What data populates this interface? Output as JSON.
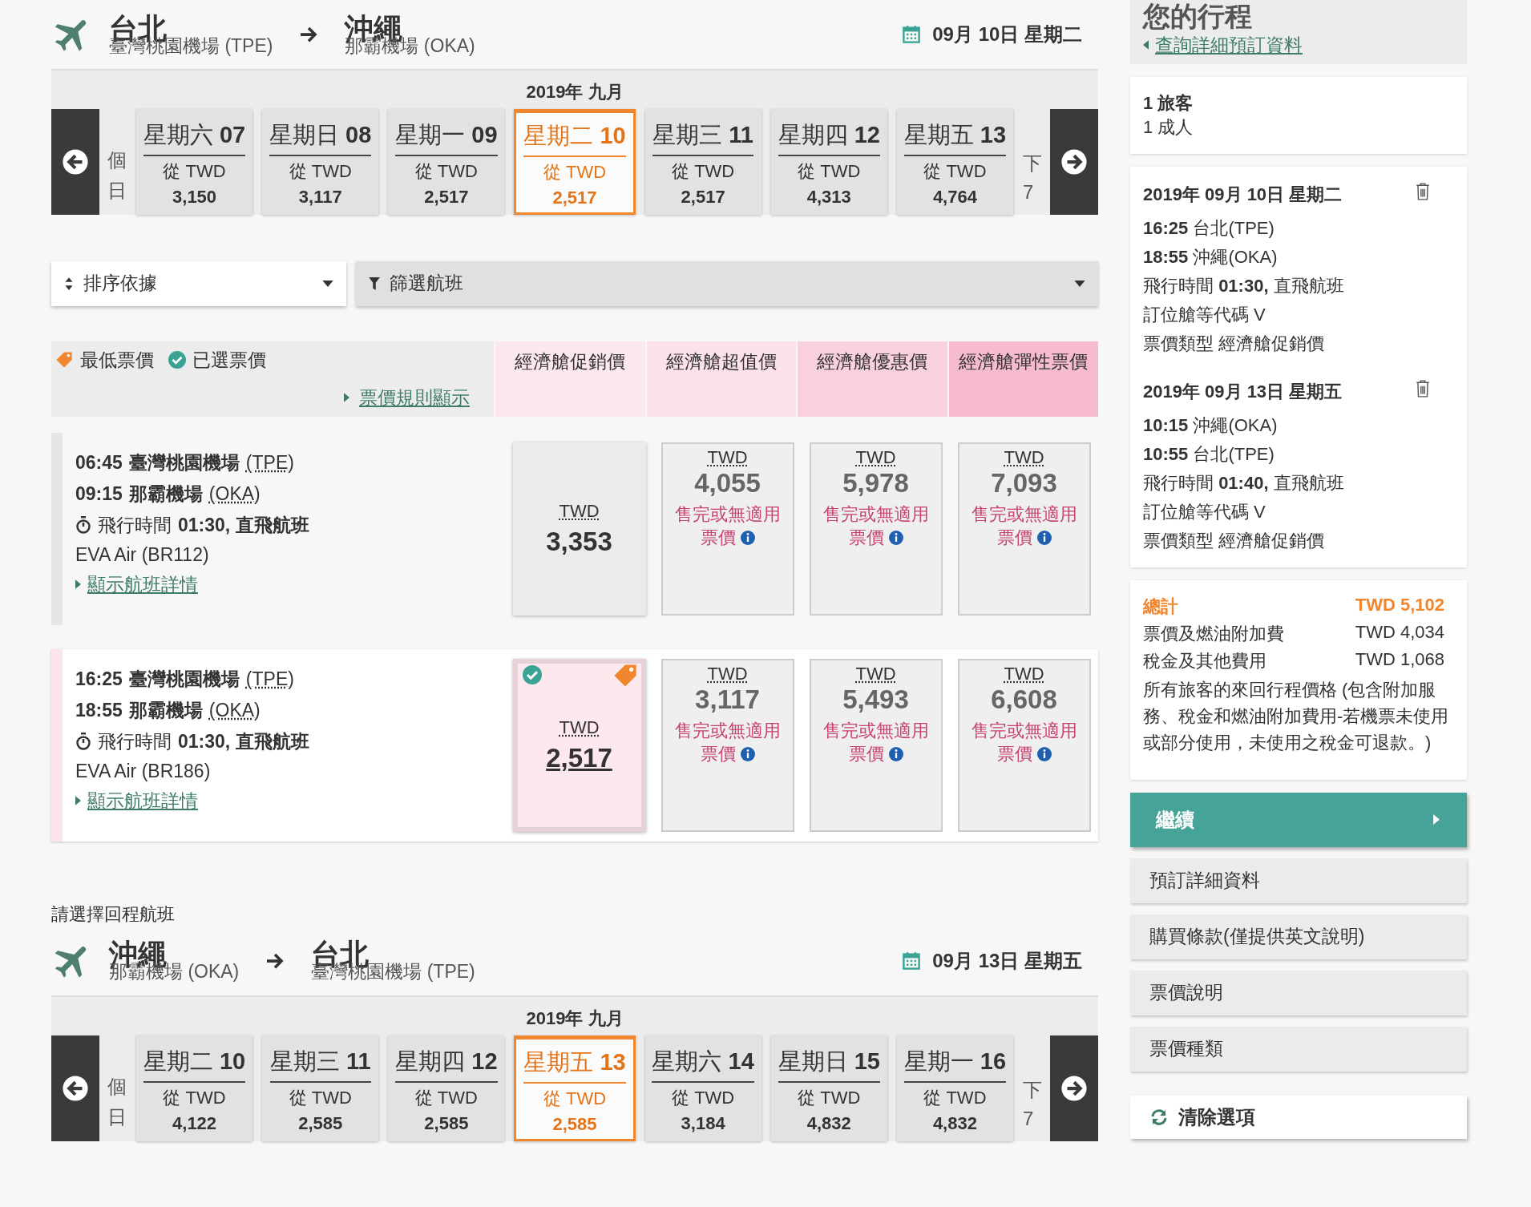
{
  "outbound": {
    "origin_city": "台北",
    "origin_airport": "臺灣桃園機場 (TPE)",
    "dest_city": "沖繩",
    "dest_airport": "那霸機場 (OKA)",
    "date": "09月 10日 星期二",
    "month": "2019年 九月",
    "prev_partial": [
      "個",
      "日"
    ],
    "next_partial": [
      "下",
      "7"
    ],
    "days": [
      {
        "day": "星期六",
        "num": "07",
        "from": "從 TWD",
        "price": "3,150",
        "selected": false
      },
      {
        "day": "星期日",
        "num": "08",
        "from": "從 TWD",
        "price": "3,117",
        "selected": false
      },
      {
        "day": "星期一",
        "num": "09",
        "from": "從 TWD",
        "price": "2,517",
        "selected": false
      },
      {
        "day": "星期二",
        "num": "10",
        "from": "從 TWD",
        "price": "2,517",
        "selected": true
      },
      {
        "day": "星期三",
        "num": "11",
        "from": "從 TWD",
        "price": "2,517",
        "selected": false
      },
      {
        "day": "星期四",
        "num": "12",
        "from": "從 TWD",
        "price": "4,313",
        "selected": false
      },
      {
        "day": "星期五",
        "num": "13",
        "from": "從 TWD",
        "price": "4,764",
        "selected": false
      }
    ]
  },
  "sort": {
    "label": "排序依據"
  },
  "filter": {
    "label": "篩選航班"
  },
  "legend": {
    "lowest": "最低票價",
    "selected": "已選票價",
    "rules_link": "票價規則顯示"
  },
  "fare_columns": [
    {
      "label": "經濟艙促銷價",
      "color": "#fde7ee"
    },
    {
      "label": "經濟艙超值價",
      "color": "#fce1e9"
    },
    {
      "label": "經濟艙優惠價",
      "color": "#f9d0de"
    },
    {
      "label": "經濟艙彈性票價",
      "color": "#f6bccd"
    }
  ],
  "flights": [
    {
      "dep_time": "06:45",
      "dep_airport": "臺灣桃園機場",
      "dep_code": "(TPE)",
      "arr_time": "09:15",
      "arr_airport": "那霸機場",
      "arr_code": "(OKA)",
      "duration_label": "飛行時間",
      "duration": "01:30, 直飛航班",
      "carrier": "EVA Air (BR112)",
      "details_link": "顯示航班詳情",
      "selected": false,
      "fares": [
        {
          "kind": "available",
          "currency": "TWD",
          "price": "3,353",
          "selected": false,
          "lowest": false
        },
        {
          "kind": "unavailable",
          "currency": "TWD",
          "price": "4,055",
          "note": "售完或無適用",
          "note_tail": "票價"
        },
        {
          "kind": "unavailable",
          "currency": "TWD",
          "price": "5,978",
          "note": "售完或無適用",
          "note_tail": "票價"
        },
        {
          "kind": "unavailable",
          "currency": "TWD",
          "price": "7,093",
          "note": "售完或無適用",
          "note_tail": "票價"
        }
      ]
    },
    {
      "dep_time": "16:25",
      "dep_airport": "臺灣桃園機場",
      "dep_code": "(TPE)",
      "arr_time": "18:55",
      "arr_airport": "那霸機場",
      "arr_code": "(OKA)",
      "duration_label": "飛行時間",
      "duration": "01:30, 直飛航班",
      "carrier": "EVA Air (BR186)",
      "details_link": "顯示航班詳情",
      "selected": true,
      "fares": [
        {
          "kind": "available",
          "currency": "TWD",
          "price": "2,517",
          "selected": true,
          "lowest": true
        },
        {
          "kind": "unavailable",
          "currency": "TWD",
          "price": "3,117",
          "note": "售完或無適用",
          "note_tail": "票價"
        },
        {
          "kind": "unavailable",
          "currency": "TWD",
          "price": "5,493",
          "note": "售完或無適用",
          "note_tail": "票價"
        },
        {
          "kind": "unavailable",
          "currency": "TWD",
          "price": "6,608",
          "note": "售完或無適用",
          "note_tail": "票價"
        }
      ]
    }
  ],
  "return_prompt": "請選擇回程航班",
  "inbound": {
    "origin_city": "沖繩",
    "origin_airport": "那霸機場 (OKA)",
    "dest_city": "台北",
    "dest_airport": "臺灣桃園機場 (TPE)",
    "date": "09月 13日 星期五",
    "month": "2019年 九月",
    "prev_partial": [
      "個",
      "日"
    ],
    "next_partial": [
      "下",
      "7"
    ],
    "days": [
      {
        "day": "星期二",
        "num": "10",
        "from": "從 TWD",
        "price": "4,122",
        "selected": false
      },
      {
        "day": "星期三",
        "num": "11",
        "from": "從 TWD",
        "price": "2,585",
        "selected": false
      },
      {
        "day": "星期四",
        "num": "12",
        "from": "從 TWD",
        "price": "2,585",
        "selected": false
      },
      {
        "day": "星期五",
        "num": "13",
        "from": "從 TWD",
        "price": "2,585",
        "selected": true
      },
      {
        "day": "星期六",
        "num": "14",
        "from": "從 TWD",
        "price": "3,184",
        "selected": false
      },
      {
        "day": "星期日",
        "num": "15",
        "from": "從 TWD",
        "price": "4,832",
        "selected": false
      },
      {
        "day": "星期一",
        "num": "16",
        "from": "從 TWD",
        "price": "4,832",
        "selected": false
      }
    ]
  },
  "sidebar": {
    "title": "您的行程",
    "back_link": "查詢詳細預訂資料",
    "travelers": "1 旅客",
    "adults": "1 成人",
    "segments": [
      {
        "date": "2019年 09月 10日 星期二",
        "dep": "**16:25** 台北(TPE)",
        "arr": "**18:55** 沖繩(OKA)",
        "duration": "飛行時間 **01:30,** 直飛航班",
        "booking_class": "訂位艙等代碼 V",
        "fare_type": "票價類型 經濟艙促銷價"
      },
      {
        "date": "2019年 09月 13日 星期五",
        "dep": "**10:15** 沖繩(OKA)",
        "arr": "**10:55** 台北(TPE)",
        "duration": "飛行時間 **01:40,** 直飛航班",
        "booking_class": "訂位艙等代碼 V",
        "fare_type": "票價類型 經濟艙促銷價"
      }
    ],
    "total_label": "總計",
    "total": "TWD 5,102",
    "breakdown": [
      {
        "label": "票價及燃油附加費",
        "amount": "TWD 4,034"
      },
      {
        "label": "稅金及其他費用",
        "amount": "TWD 1,068"
      }
    ],
    "note": "所有旅客的來回行程價格 (包含附加服務、稅金和燃油附加費用-若機票未使用或部分使用，未使用之稅金可退款。)",
    "continue": "繼續",
    "buttons": [
      "預訂詳細資料",
      "購買條款(僅提供英文說明)",
      "票價說明",
      "票價種類"
    ],
    "clear": "清除選項"
  }
}
